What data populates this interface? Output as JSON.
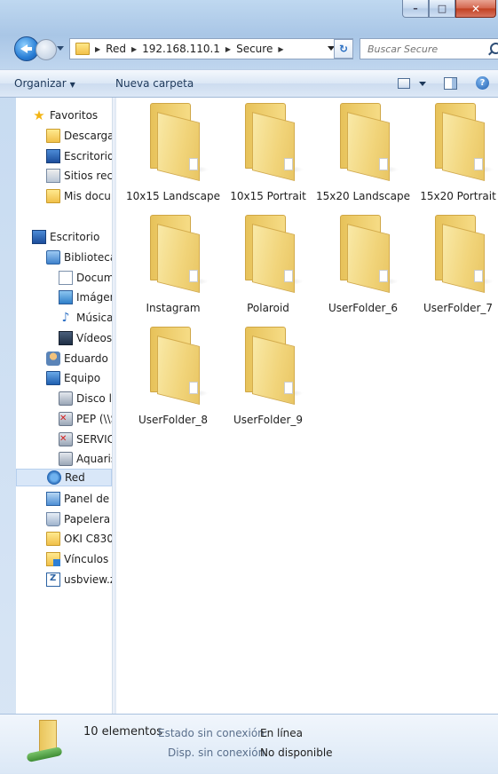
{
  "window": {
    "minimize_glyph": "–",
    "maximize_glyph": "□",
    "close_glyph": "✕"
  },
  "address": {
    "crumbs": [
      "Red",
      "192.168.110.1",
      "Secure"
    ],
    "refresh_glyph": "↻",
    "search_placeholder": "Buscar Secure"
  },
  "toolbar": {
    "organize_label": "Organizar",
    "new_folder_label": "Nueva carpeta",
    "help_glyph": "?"
  },
  "sidebar": {
    "items": [
      {
        "label": "Favoritos",
        "icon": "star-icon"
      },
      {
        "label": "Descargas",
        "icon": "downloads-folder-icon"
      },
      {
        "label": "Escritorio",
        "icon": "desktop-icon"
      },
      {
        "label": "Sitios recier",
        "icon": "recent-places-icon"
      },
      {
        "label": "Mis docum",
        "icon": "documents-folder-icon"
      },
      {
        "label": "Escritorio",
        "icon": "desktop-icon"
      },
      {
        "label": "Bibliotecas",
        "icon": "libraries-icon"
      },
      {
        "label": "Documer",
        "icon": "document-icon"
      },
      {
        "label": "Imágene",
        "icon": "pictures-icon"
      },
      {
        "label": "Música",
        "icon": "music-icon"
      },
      {
        "label": "Vídeos",
        "icon": "videos-icon"
      },
      {
        "label": "Eduardo Ga",
        "icon": "user-icon"
      },
      {
        "label": "Equipo",
        "icon": "computer-icon"
      },
      {
        "label": "Disco loc",
        "icon": "local-disk-icon"
      },
      {
        "label": "PEP (\\\\SF",
        "icon": "disconnected-drive-icon"
      },
      {
        "label": "SERVICES",
        "icon": "disconnected-drive-icon"
      },
      {
        "label": "Aquaris N",
        "icon": "device-icon"
      },
      {
        "label": "Red",
        "icon": "network-icon"
      },
      {
        "label": "Panel de cc",
        "icon": "control-panel-icon"
      },
      {
        "label": "Papelera de",
        "icon": "recycle-bin-icon"
      },
      {
        "label": "OKI C830",
        "icon": "folder-icon"
      },
      {
        "label": "Vínculos",
        "icon": "links-icon"
      },
      {
        "label": "usbview.zip",
        "icon": "zip-file-icon"
      }
    ]
  },
  "folders": [
    {
      "name": "10x15 Landscape"
    },
    {
      "name": "10x15 Portrait"
    },
    {
      "name": "15x20 Landscape"
    },
    {
      "name": "15x20 Portrait"
    },
    {
      "name": "Instagram"
    },
    {
      "name": "Polaroid"
    },
    {
      "name": "UserFolder_6"
    },
    {
      "name": "UserFolder_7"
    },
    {
      "name": "UserFolder_8"
    },
    {
      "name": "UserFolder_9"
    }
  ],
  "details": {
    "count": "10 elementos",
    "offline_status_label": "Estado sin conexión:",
    "offline_status_value": "En línea",
    "offline_availability_label": "Disp. sin conexión:",
    "offline_availability_value": "No disponible"
  }
}
